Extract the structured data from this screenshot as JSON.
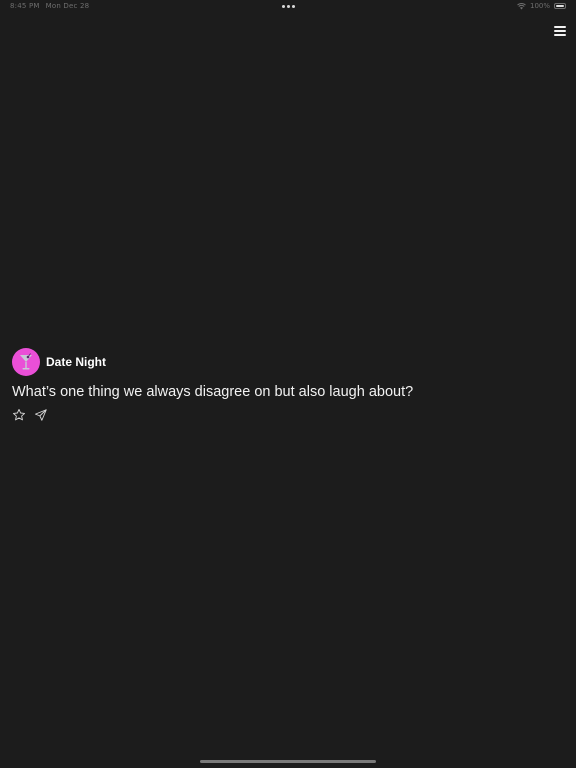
{
  "status_bar": {
    "time": "8:45 PM",
    "date": "Mon Dec 28",
    "battery_percent": "100%"
  },
  "card": {
    "category": "Date Night",
    "question": "What’s one thing we always disagree on but also laugh about?",
    "avatar_icon": "cocktail-glass-icon",
    "avatar_color": "#ea4fd7"
  },
  "actions": {
    "favorite_icon": "star-icon",
    "share_icon": "paper-plane-icon"
  },
  "menu_icon": "hamburger-menu-icon"
}
